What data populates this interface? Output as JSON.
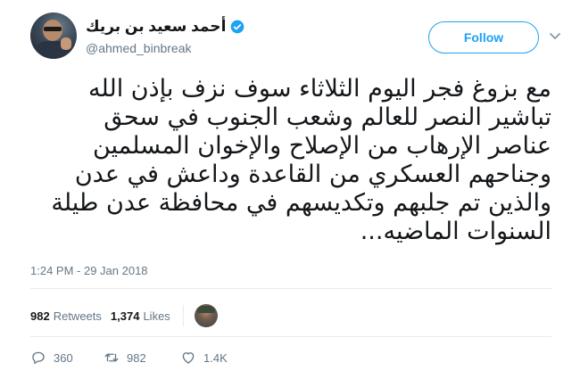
{
  "tweet": {
    "author": {
      "name": "أحمد سعيد بن بريك",
      "handle": "@ahmed_binbreak",
      "verified": true
    },
    "follow_label": "Follow",
    "text": "مع بزوغ فجر اليوم الثلاثاء سوف نزف بإذن الله\nتباشير النصر  للعالم وشعب الجنوب في سحق\nعناصر الإرهاب من الإصلاح والإخوان المسلمين\nوجناحهم العسكري من القاعدة وداعش في عدن\nوالذين تم جلبهم وتكديسهم في محافظة عدن طيلة\nالسنوات الماضيه...",
    "timestamp": "1:24 PM - 29 Jan 2018",
    "stats": {
      "retweets_count": "982",
      "retweets_label": "Retweets",
      "likes_count": "1,374",
      "likes_label": "Likes"
    },
    "actions": {
      "replies": "360",
      "retweets": "982",
      "likes": "1.4K"
    }
  },
  "icons": {
    "verified": "verified-badge-icon",
    "chevron": "chevron-down-icon",
    "reply": "reply-icon",
    "retweet": "retweet-icon",
    "like": "heart-icon"
  },
  "colors": {
    "accent": "#1da1f2",
    "text": "#14171a",
    "secondary": "#657786",
    "divider": "#e6ecf0"
  }
}
